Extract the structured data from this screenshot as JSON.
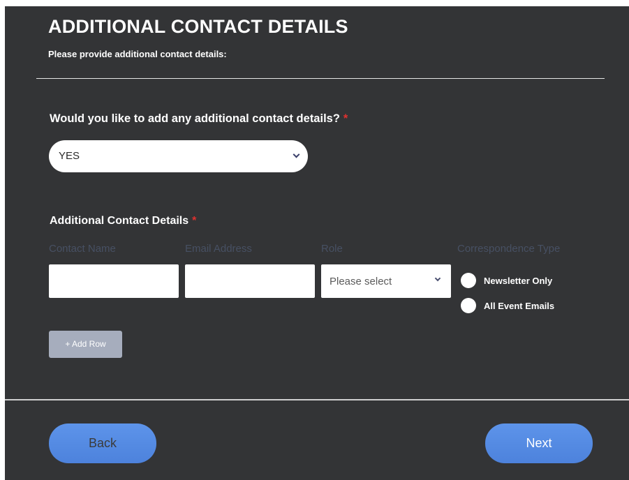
{
  "header": {
    "title": "ADDITIONAL CONTACT DETAILS",
    "subtitle": "Please provide additional contact details:"
  },
  "question": {
    "label": "Would you like to add any additional contact details?",
    "required_mark": "*",
    "selected_value": "YES"
  },
  "contacts": {
    "label": "Additional Contact Details",
    "required_mark": "*",
    "columns": [
      "Contact Name",
      "Email Address",
      "Role",
      "Correspondence Type"
    ],
    "rows": [
      {
        "contact_name": "",
        "email_address": "",
        "role_placeholder": "Please select",
        "correspondence_options": [
          "Newsletter Only",
          "All Event Emails"
        ]
      }
    ],
    "add_row_label": "+ Add Row"
  },
  "footer": {
    "back_label": "Back",
    "next_label": "Next"
  },
  "colors": {
    "panel_background": "#333436",
    "required": "#e0312f",
    "button_blue": "#5588e2",
    "add_row_button": "#a6adbd",
    "column_header": "#475063"
  },
  "icons": {
    "dropdown": "chevron-down-icon",
    "radio": "radio-unselected-icon"
  }
}
